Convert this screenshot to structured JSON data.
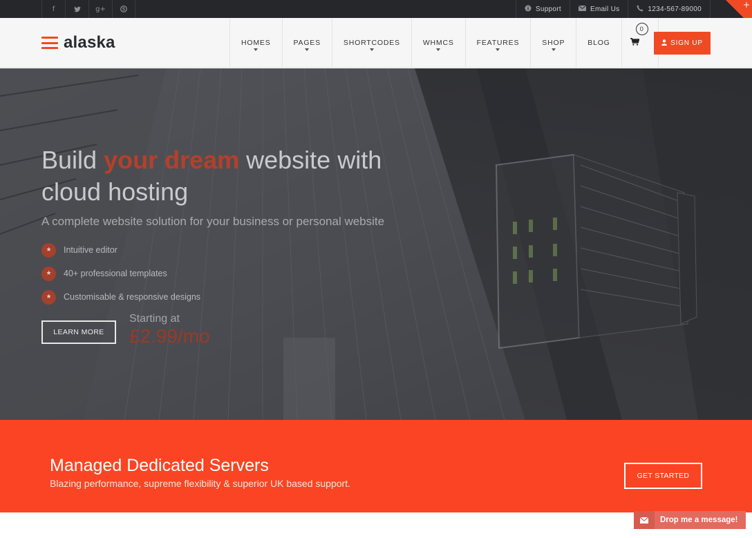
{
  "topbar": {
    "social": [
      "f",
      "t",
      "g+",
      "s"
    ],
    "social_icons": [
      "facebook-icon",
      "twitter-icon",
      "google-plus-icon",
      "skype-icon"
    ],
    "support": "Support",
    "email": "Email Us",
    "phone": "1234-567-89000",
    "corner_symbol": "+"
  },
  "header": {
    "logo": "alaska",
    "nav": [
      "HOMES",
      "PAGES",
      "SHORTCODES",
      "WHMCS",
      "FEATURES",
      "SHOP",
      "BLOG"
    ],
    "cart_count": "0",
    "signup": "SIGN UP"
  },
  "hero": {
    "title_pre": "Build ",
    "title_accent": "your dream",
    "title_post": " website with cloud hosting",
    "subtitle": "A complete website solution for your business or personal website",
    "features": [
      "Intuitive editor",
      "40+ professional templates",
      "Customisable & responsive designs"
    ],
    "learn_more": "LEARN MORE",
    "starting_at": "Starting at",
    "price": "£2.99/mo"
  },
  "band": {
    "title": "Managed Dedicated Servers",
    "subtitle": "Blazing performance, supreme flexibility & superior UK based support.",
    "cta": "GET STARTED"
  },
  "chat": {
    "label": "Drop me a message!"
  },
  "colors": {
    "accent": "#f04a25",
    "topbar": "#26272b",
    "band": "#fb4423"
  }
}
